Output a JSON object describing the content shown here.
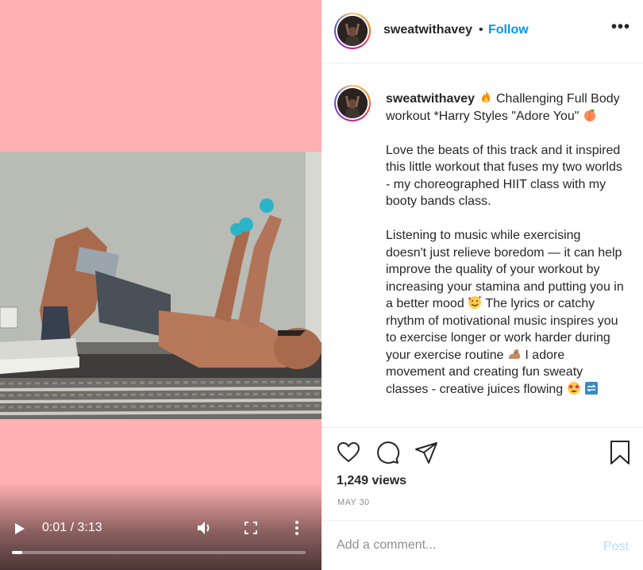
{
  "video": {
    "current_time": "0:01",
    "duration": "3:13",
    "time_display": "0:01 / 3:13",
    "progress_fraction": 0.01,
    "background_color": "#ffb0b0"
  },
  "post": {
    "author": "sweatwithavey",
    "follow_separator": "•",
    "follow_label": "Follow",
    "options_label": "•••",
    "caption": {
      "author": "sweatwithavey",
      "line1_a": " ",
      "line1_b": " Challenging Full Body workout *Harry Styles \"Adore You\" ",
      "para2": "Love the beats of this track and it inspired this little workout that fuses my two worlds - my choreographed HIIT class with my booty bands class.",
      "para3_a": "Listening to music while exercising doesn't just relieve boredom — it can help improve the quality of your workout by increasing your stamina and putting you in a better mood ",
      "para3_b": " The lyrics or catchy rhythm of motivational music inspires you to exercise longer or work harder during your exercise routine ",
      "para3_c": " I adore movement and creating fun sweaty classes - creative juices flowing ",
      "emojis": [
        "fire-emoji",
        "peach-emoji",
        "smiling-face-with-hearts-emoji",
        "flexed-biceps-emoji",
        "star-struck-emoji",
        "arrows-emoji"
      ]
    },
    "views": "1,249 views",
    "date": "MAY 30",
    "comment_placeholder": "Add a comment...",
    "post_label": "Post"
  },
  "icons": {
    "like": "heart-icon",
    "comment": "comment-icon",
    "share": "paper-plane-icon",
    "save": "bookmark-icon",
    "play": "play-icon",
    "volume": "volume-icon",
    "fullscreen": "fullscreen-icon",
    "more": "more-vertical-icon"
  },
  "colors": {
    "link_blue": "#0095f6",
    "post_disabled": "#b2dffc",
    "muted": "#8e8e8e"
  }
}
